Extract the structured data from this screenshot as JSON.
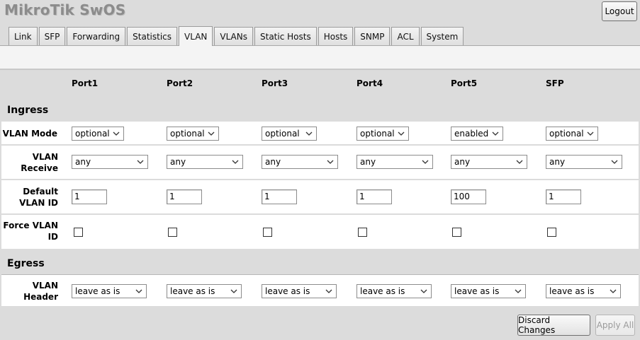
{
  "app": {
    "brand": "MikroTik SwOS",
    "logout_label": "Logout"
  },
  "tabs": [
    {
      "label": "Link"
    },
    {
      "label": "SFP"
    },
    {
      "label": "Forwarding"
    },
    {
      "label": "Statistics"
    },
    {
      "label": "VLAN",
      "active": true
    },
    {
      "label": "VLANs"
    },
    {
      "label": "Static Hosts"
    },
    {
      "label": "Hosts"
    },
    {
      "label": "SNMP"
    },
    {
      "label": "ACL"
    },
    {
      "label": "System"
    }
  ],
  "ports": [
    "Port1",
    "Port2",
    "Port3",
    "Port4",
    "Port5",
    "SFP"
  ],
  "ingress": {
    "title": "Ingress",
    "vlan_mode": {
      "label": "VLAN Mode",
      "values": [
        "optional",
        "optional",
        "optional",
        "optional",
        "enabled",
        "optional"
      ]
    },
    "vlan_receive": {
      "label_line1": "VLAN",
      "label_line2": "Receive",
      "values": [
        "any",
        "any",
        "any",
        "any",
        "any",
        "any"
      ]
    },
    "default_vlan_id": {
      "label_line1": "Default",
      "label_line2": "VLAN ID",
      "values": [
        "1",
        "1",
        "1",
        "1",
        "100",
        "1"
      ]
    },
    "force_vlan_id": {
      "label_line1": "Force VLAN",
      "label_line2": "ID",
      "values": [
        false,
        false,
        false,
        false,
        false,
        false
      ]
    }
  },
  "egress": {
    "title": "Egress",
    "vlan_header": {
      "label_line1": "VLAN",
      "label_line2": "Header",
      "values": [
        "leave as is",
        "leave as is",
        "leave as is",
        "leave as is",
        "leave as is",
        "leave as is"
      ]
    }
  },
  "actions": {
    "discard_label": "Discard Changes",
    "apply_label": "Apply All"
  }
}
